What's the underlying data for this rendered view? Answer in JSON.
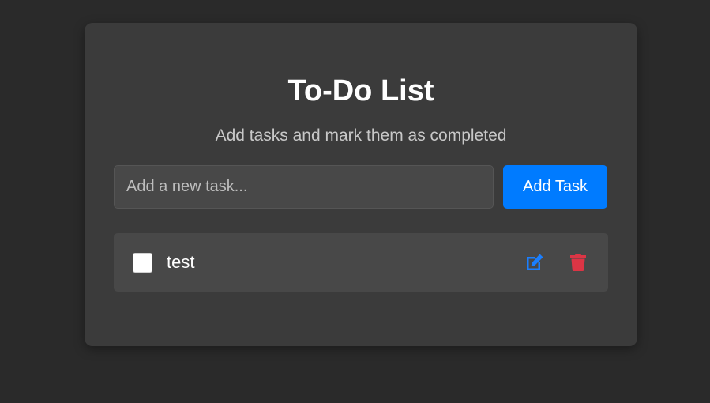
{
  "app": {
    "title": "To-Do List",
    "subtitle": "Add tasks and mark them as completed"
  },
  "form": {
    "placeholder": "Add a new task...",
    "value": "",
    "add_label": "Add Task"
  },
  "tasks": [
    {
      "text": "test",
      "completed": false,
      "edit_icon": "edit-icon",
      "delete_icon": "trash-icon"
    }
  ],
  "colors": {
    "accent": "#007bff",
    "edit": "#1a7fff",
    "delete": "#dc3545",
    "card": "#3b3b3b",
    "background": "#2a2a2a"
  }
}
